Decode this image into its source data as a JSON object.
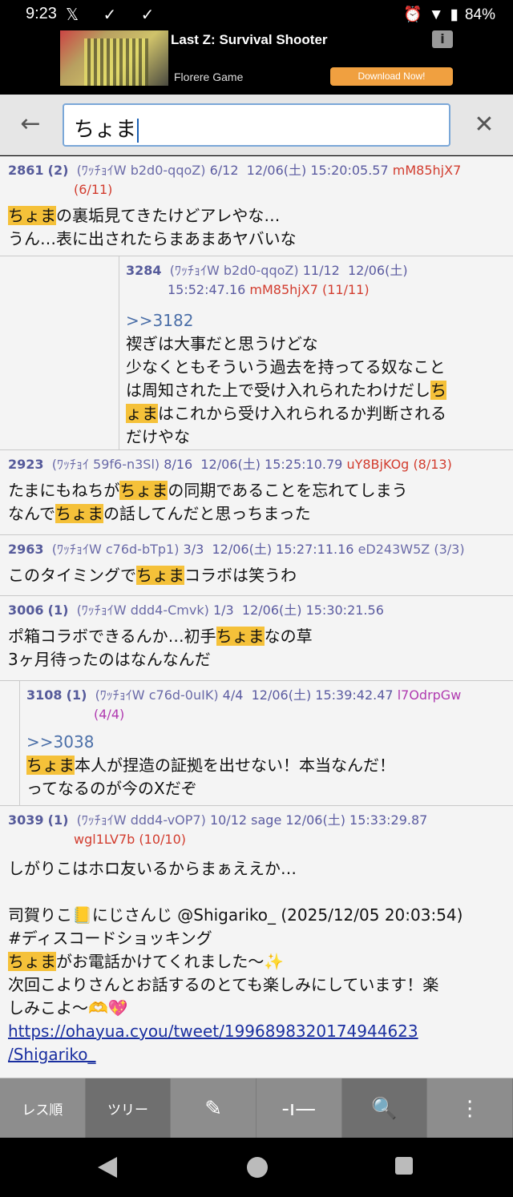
{
  "status_bar": {
    "time": "9:23",
    "left_icons": "𝕏 ✓ ✓",
    "alarm": "⏰",
    "wifi": "▼",
    "battery_icon": "▮",
    "battery": "84%"
  },
  "ad": {
    "title": "Last Z: Survival Shooter",
    "developer": "Florere Game",
    "cta": "Download Now!",
    "info_icon": "i"
  },
  "appbar": {
    "back_icon": "←",
    "search_value": "ちょま",
    "clear_icon": "✕"
  },
  "posts": [
    {
      "no": "2861",
      "count": "(2)",
      "name": "(ﾜｯﾁｮｲW b2d0-qqoZ)",
      "frac": "6/12",
      "date": "12/06(土) 15:20:05.57",
      "id": "mM85hjX7",
      "idc": "(6/11)",
      "lines": [
        [
          "",
          "ちょま",
          "の裏垢見てきたけどアレやな…"
        ],
        [
          "うん…表に出されたらまあまあヤバいな"
        ]
      ]
    },
    {
      "no": "3284",
      "name": "(ﾜｯﾁｮｲW b2d0-qqoZ)",
      "frac": "11/12",
      "date_a": "12/06(土)",
      "date_b": "15:52:47.16",
      "id": "mM85hjX7",
      "idc": "(11/11)",
      "anchor": ">>3182",
      "text1": "禊ぎは大事だと思うけどな",
      "text2": "少なくともそういう過去を持ってる奴なこと",
      "text3": "は周知された上で受け入れられたわけだし",
      "hl_a": "ち",
      "hl_b": "ょま",
      "text4": "はこれから受け入れられるか判断される",
      "text5": "だけやな"
    },
    {
      "no": "2923",
      "name": "(ﾜｯﾁｮｲ 59f6-n3Sl)",
      "frac": "8/16",
      "date": "12/06(土) 15:25:10.79",
      "id": "uY8BjKOg",
      "idc": "(8/13)",
      "t1a": "たまにもねちが",
      "hl1": "ちょま",
      "t1b": "の同期であることを忘れてしまう",
      "t2a": "なんで",
      "hl2": "ちょま",
      "t2b": "の話してんだと思っちまった"
    },
    {
      "no": "2963",
      "name": "(ﾜｯﾁｮｲW c76d-bTp1)",
      "frac": "3/3",
      "date": "12/06(土) 15:27:11.16",
      "id": "eD243W5Z",
      "idc": "(3/3)",
      "t1a": "このタイミングで",
      "hl1": "ちょま",
      "t1b": "コラボは笑うわ"
    },
    {
      "no": "3006",
      "count": "(1)",
      "name": "(ﾜｯﾁｮｲW ddd4-Cmvk)",
      "frac": "1/3",
      "date": "12/06(土) 15:30:21.56",
      "t1a": "ポ箱コラボできるんか…初手",
      "hl1": "ちょま",
      "t1b": "なの草",
      "t2": "3ヶ月待ったのはなんなんだ"
    },
    {
      "no": "3108",
      "count": "(1)",
      "name": "(ﾜｯﾁｮｲW c76d-0uIK)",
      "frac": "4/4",
      "date": "12/06(土) 15:39:42.47",
      "id": "l7OdrpGw",
      "idc": "(4/4)",
      "anchor": ">>3038",
      "hl1": "ちょま",
      "t1b": "本人が捏造の証拠を出せない！本当なんだ！",
      "t2": "ってなるのが今のXだぞ"
    },
    {
      "no": "3039",
      "count": "(1)",
      "name": "(ﾜｯﾁｮｲW ddd4-vOP7)",
      "frac": "10/12",
      "sage": "sage",
      "date": "12/06(土) 15:33:29.87",
      "id": "wgl1LV7b",
      "idc": "(10/10)",
      "t1": "しがりこはホロ友いるからまぁええか…",
      "t2": "司賀りこ📒にじさんじ @Shigariko_ (2025/12/05 20:03:54)",
      "t3": "#ディスコードショッキング",
      "hl1": "ちょま",
      "t4b": "がお電話かけてくれました～✨",
      "t5": "次回こよりさんとお話するのとても楽しみにしています！楽",
      "t6": "しみこよ～🫶💖",
      "link1": "https://ohayua.cyou/tweet/1996898320174944623",
      "link2": "/Shigariko_"
    }
  ],
  "toolbar": {
    "res_order": "レス順",
    "tree": "ツリー",
    "edit_icon": "✎",
    "slider_icon": "-ı—",
    "search_icon": "🔍",
    "more_icon": "⋮"
  }
}
